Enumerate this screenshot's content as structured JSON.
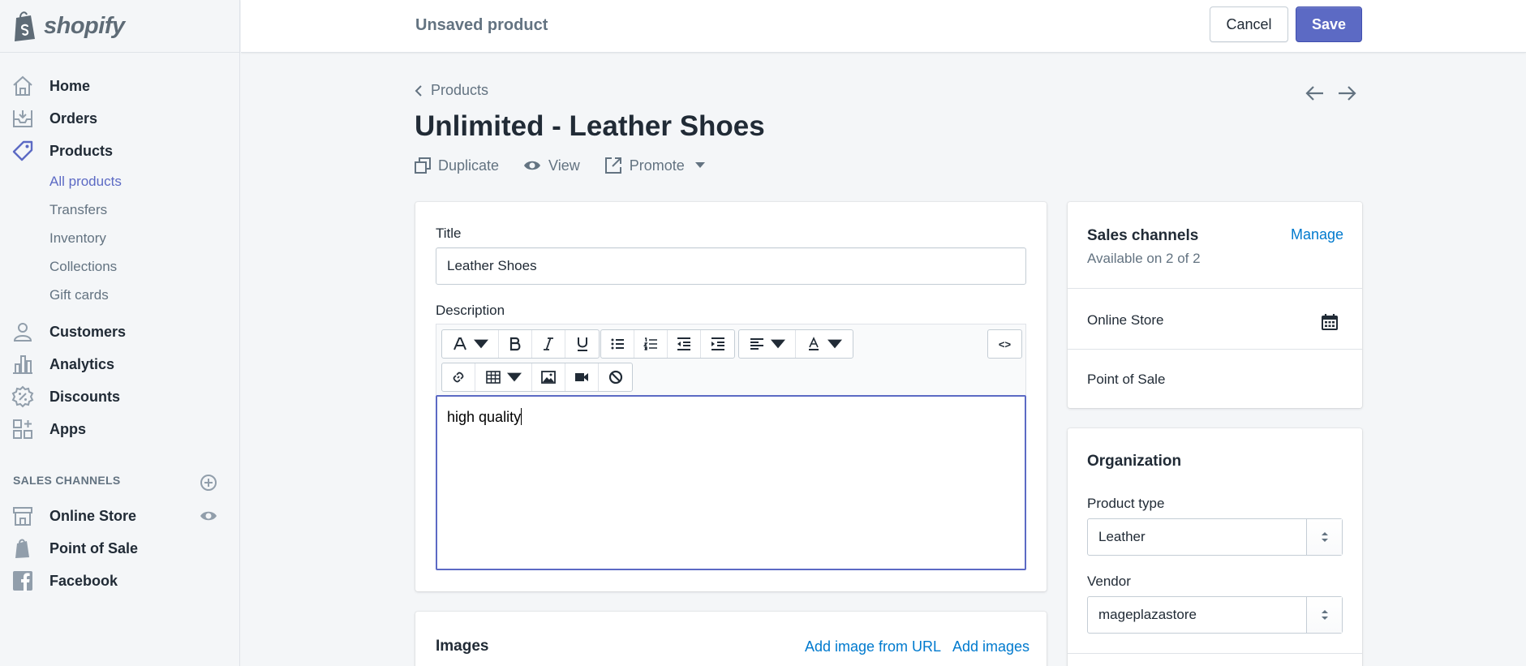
{
  "brand": {
    "name": "shopify",
    "color": "#5e6b76"
  },
  "accent": "#5c6ac4",
  "link_color": "#007ace",
  "topbar": {
    "title": "Unsaved product",
    "cancel_label": "Cancel",
    "save_label": "Save"
  },
  "sidebar": {
    "items": [
      {
        "label": "Home",
        "icon": "home-icon"
      },
      {
        "label": "Orders",
        "icon": "orders-icon"
      },
      {
        "label": "Products",
        "icon": "tag-icon"
      }
    ],
    "product_subitems": [
      "All products",
      "Transfers",
      "Inventory",
      "Collections",
      "Gift cards"
    ],
    "items_after": [
      {
        "label": "Customers",
        "icon": "person-icon"
      },
      {
        "label": "Analytics",
        "icon": "bar-chart-icon"
      },
      {
        "label": "Discounts",
        "icon": "discount-icon"
      },
      {
        "label": "Apps",
        "icon": "apps-icon"
      }
    ],
    "sales_channels_heading": "SALES CHANNELS",
    "sales_channels": [
      {
        "label": "Online Store",
        "icon": "store-icon"
      },
      {
        "label": "Point of Sale",
        "icon": "pos-icon"
      },
      {
        "label": "Facebook",
        "icon": "facebook-icon"
      }
    ]
  },
  "page": {
    "breadcrumb": "Products",
    "title": "Unlimited - Leather Shoes",
    "actions": {
      "duplicate": "Duplicate",
      "view": "View",
      "promote": "Promote"
    }
  },
  "product_card": {
    "title_label": "Title",
    "title_value": "Leather Shoes",
    "description_label": "Description",
    "description_value": "high quality",
    "html_toggle": "<>"
  },
  "images_card": {
    "heading": "Images",
    "add_from_url": "Add image from URL",
    "add_images": "Add images"
  },
  "sales_channels_card": {
    "heading": "Sales channels",
    "manage": "Manage",
    "availability": "Available on 2 of 2",
    "channels": [
      "Online Store",
      "Point of Sale"
    ]
  },
  "organization_card": {
    "heading": "Organization",
    "product_type_label": "Product type",
    "product_type_value": "Leather",
    "vendor_label": "Vendor",
    "vendor_value": "mageplazastore"
  }
}
